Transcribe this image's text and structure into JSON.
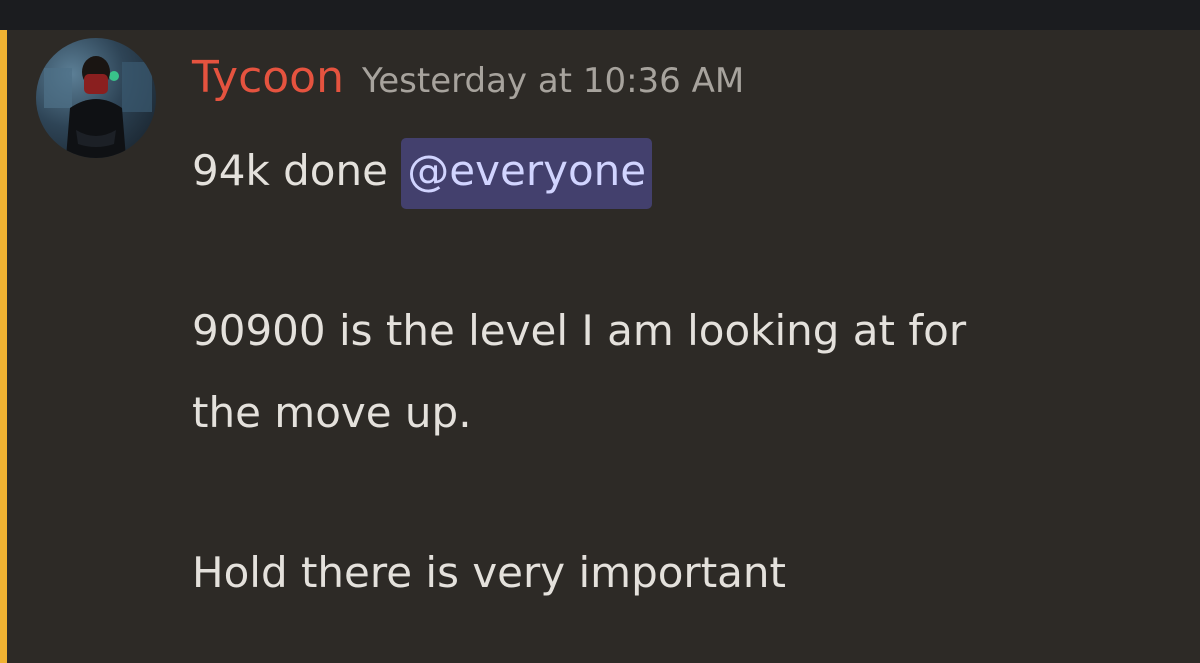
{
  "message": {
    "author": {
      "name": "Tycoon",
      "name_color": "#e5533f",
      "avatar_icon": "user-avatar"
    },
    "timestamp": "Yesterday at 10:36 AM",
    "highlight_color": "#f0b232",
    "lines": {
      "line1_text": "94k done ",
      "mention": "@everyone",
      "line2": "90900 is the level I am looking at for",
      "line3": "the move up.",
      "line4": "Hold there is very important"
    }
  }
}
